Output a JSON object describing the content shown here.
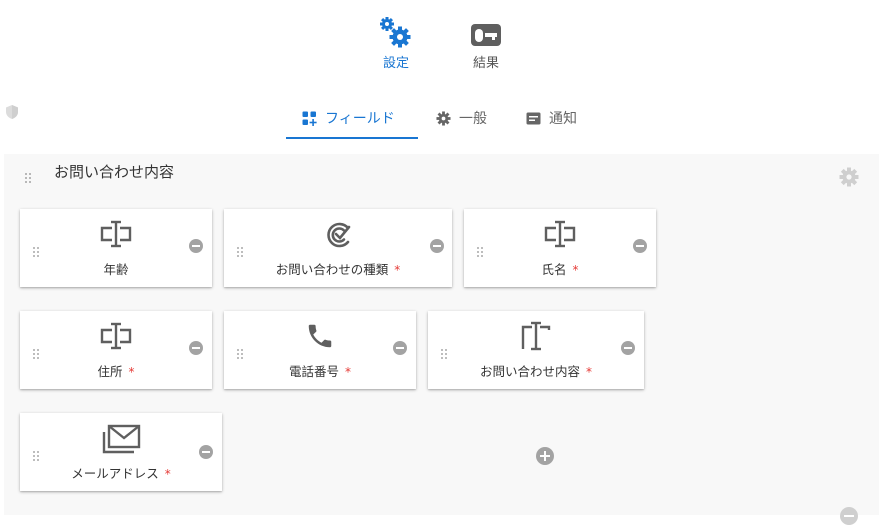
{
  "modes": {
    "settings_label": "設定",
    "results_label": "結果"
  },
  "tabs": {
    "fields_label": "フィールド",
    "general_label": "一般",
    "notify_label": "通知"
  },
  "section": {
    "title": "お問い合わせ内容"
  },
  "fields": [
    {
      "label": "年齢",
      "required": false,
      "icon": "number-field-icon"
    },
    {
      "label": "お問い合わせの種類",
      "required": true,
      "req_mark": "*",
      "icon": "check-circle-icon"
    },
    {
      "label": "氏名",
      "required": true,
      "req_mark": "*",
      "icon": "text-field-icon"
    },
    {
      "label": "住所",
      "required": true,
      "req_mark": "*",
      "icon": "text-field-icon"
    },
    {
      "label": "電話番号",
      "required": true,
      "req_mark": "*",
      "icon": "phone-icon"
    },
    {
      "label": "お問い合わせ内容",
      "required": true,
      "req_mark": "*",
      "icon": "textarea-icon"
    },
    {
      "label": "メールアドレス",
      "required": true,
      "req_mark": "*",
      "icon": "mail-icon"
    }
  ],
  "colors": {
    "accent": "#1976d2",
    "required": "#e53935",
    "icon_gray": "#5f5f5f",
    "button_gray": "#a3a3a3"
  }
}
